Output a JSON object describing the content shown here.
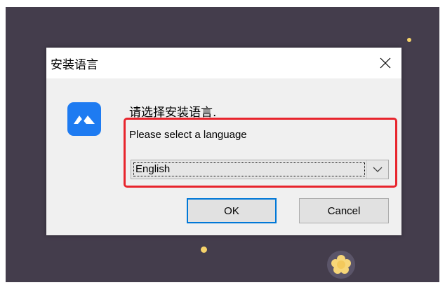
{
  "dialog": {
    "title": "安装语言",
    "prompt_cn": "请选择安装语言.",
    "prompt_en": "Please select a language",
    "language_select": {
      "selected": "English"
    },
    "ok_label": "OK",
    "cancel_label": "Cancel"
  },
  "icons": {
    "close": "close-icon",
    "app": "app-logo-icon",
    "dropdown": "chevron-down-icon"
  },
  "colors": {
    "desktop_background": "#443d4c",
    "dialog_background": "#f0f0f0",
    "app_icon_blue": "#1e7bf1",
    "highlight_red": "#e8252d",
    "focus_blue": "#0078d7",
    "accent_yellow": "#f6d36a"
  }
}
